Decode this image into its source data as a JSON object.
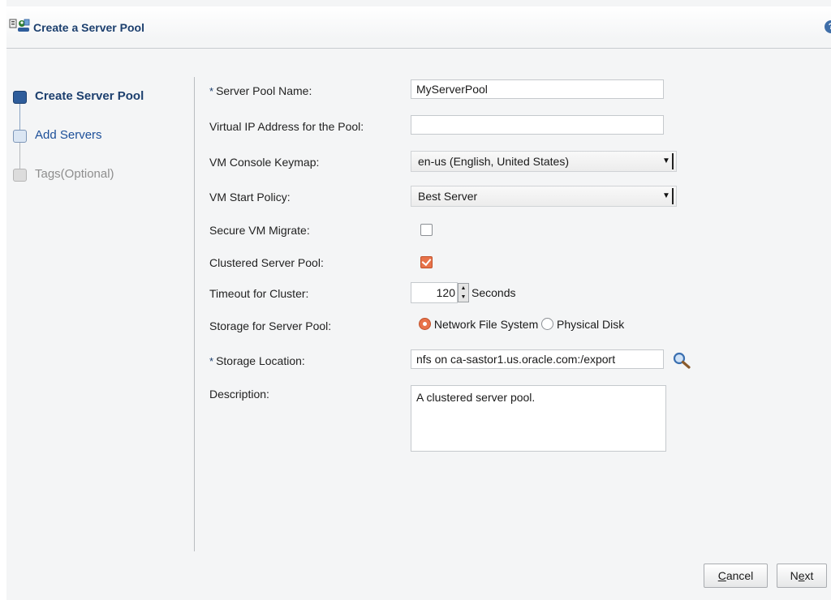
{
  "dialog": {
    "title": "Create a Server Pool",
    "help": "?"
  },
  "train": {
    "steps": [
      {
        "label": "Create Server Pool",
        "state": "current"
      },
      {
        "label": "Add Servers",
        "state": "link"
      },
      {
        "label": "Tags(Optional)",
        "state": "disabled"
      }
    ]
  },
  "form": {
    "required_marker": "*",
    "server_pool_name": {
      "label": "Server Pool Name:",
      "value": "MyServerPool"
    },
    "virtual_ip": {
      "label": "Virtual IP Address for the Pool:",
      "value": ""
    },
    "keymap": {
      "label": "VM Console Keymap:",
      "value": "en-us (English, United States)"
    },
    "start_policy": {
      "label": "VM Start Policy:",
      "value": "Best Server"
    },
    "secure_migrate": {
      "label": "Secure VM Migrate:",
      "checked": false
    },
    "clustered": {
      "label": "Clustered Server Pool:",
      "checked": true
    },
    "timeout": {
      "label": "Timeout for Cluster:",
      "value": "120",
      "unit": "Seconds"
    },
    "storage": {
      "label": "Storage for Server Pool:",
      "options": [
        "Network File System",
        "Physical Disk"
      ],
      "selected": "Network File System"
    },
    "storage_location": {
      "label": "Storage Location:",
      "value": "nfs on ca-sastor1.us.oracle.com:/export"
    },
    "description": {
      "label": "Description:",
      "value": "A clustered server pool."
    }
  },
  "buttons": {
    "cancel": {
      "mnemonic": "C",
      "rest": "ancel"
    },
    "next": {
      "pre": "N",
      "mnemonic": "e",
      "rest": "xt"
    }
  },
  "colors": {
    "accent": "#1c3f6e",
    "checked": "#e8734a",
    "link": "#1c4f99"
  },
  "icons": {
    "title": "server-pool-icon",
    "help": "help-icon",
    "search": "search-icon"
  }
}
